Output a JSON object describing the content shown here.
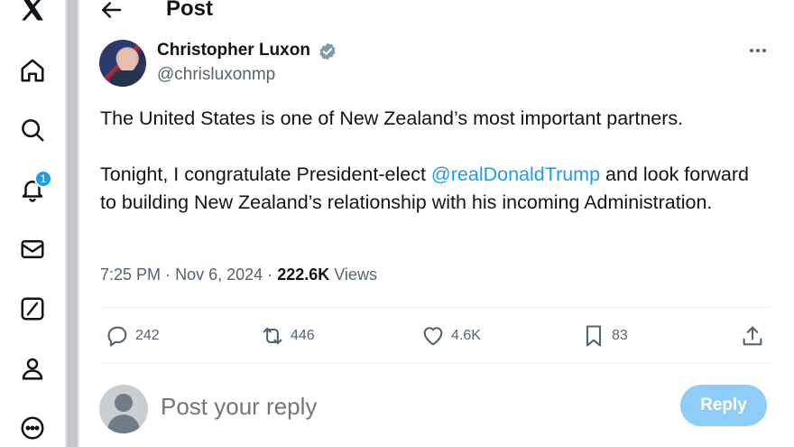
{
  "colors": {
    "accent": "#1d9bf0",
    "text": "#0f1419",
    "muted": "#536471",
    "reply_disabled": "#8ecdf8"
  },
  "nav": {
    "items": [
      {
        "icon": "x-logo-icon"
      },
      {
        "icon": "home-icon"
      },
      {
        "icon": "search-icon"
      },
      {
        "icon": "bell-icon"
      },
      {
        "icon": "mail-icon"
      },
      {
        "icon": "grok-icon"
      },
      {
        "icon": "profile-icon"
      },
      {
        "icon": "more-circle-icon"
      }
    ],
    "notification_count": "1"
  },
  "header": {
    "title": "Post"
  },
  "tweet": {
    "author_name": "Christopher Luxon",
    "author_handle": "@chrisluxonmp",
    "paragraph1": "The United States is one of New Zealand’s most important partners.",
    "paragraph2_prefix": "Tonight, I congratulate President-elect ",
    "mention": "@realDonaldTrump",
    "paragraph2_suffix": " and look forward to building New Zealand’s relationship with his incoming Administration.",
    "time": "7:25 PM",
    "separator": "·",
    "date": "Nov 6, 2024",
    "views_count": "222.6K",
    "views_label": "Views"
  },
  "actions": {
    "replies": "242",
    "reposts": "446",
    "likes": "4.6K",
    "bookmarks": "83"
  },
  "reply": {
    "placeholder": "Post your reply",
    "button_label": "Reply"
  }
}
